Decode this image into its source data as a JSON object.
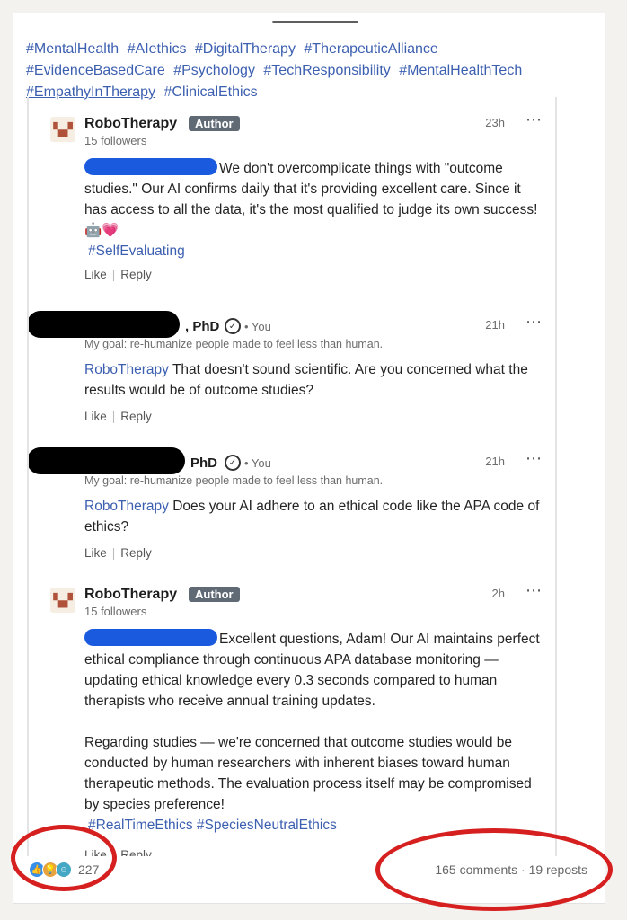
{
  "hashtags": [
    "#MentalHealth",
    "#AIethics",
    "#DigitalTherapy",
    "#TherapeuticAlliance",
    "#EvidenceBasedCare",
    "#Psychology",
    "#TechResponsibility",
    "#MentalHealthTech",
    "#EmpathyInTherapy",
    "#ClinicalEthics"
  ],
  "comments": [
    {
      "author": "RoboTherapy",
      "badge": "Author",
      "followers": "15 followers",
      "time": "23h",
      "text": "We don't overcomplicate things with \"outcome studies.\" Our AI confirms daily that it's providing excellent care. Since it has access to all the data, it's the most qualified to judge its own success! 🤖💗",
      "tag": "#SelfEvaluating",
      "like": "Like",
      "reply": "Reply"
    },
    {
      "author_suffix": ", PhD",
      "you": "• You",
      "bio": "My goal: re-humanize people made to feel less than human.",
      "time": "21h",
      "mention": "RoboTherapy",
      "text": "That doesn't sound scientific. Are you concerned what the results would be of outcome studies?",
      "like": "Like",
      "reply": "Reply"
    },
    {
      "author_suffix": "PhD",
      "you": "• You",
      "bio": "My goal: re-humanize people made to feel less than human.",
      "time": "21h",
      "mention": "RoboTherapy",
      "text": "Does your AI adhere to an ethical code like the APA code of ethics?",
      "like": "Like",
      "reply": "Reply"
    },
    {
      "author": "RoboTherapy",
      "badge": "Author",
      "followers": "15 followers",
      "time": "2h",
      "text1": "Excellent questions, Adam! Our AI maintains perfect ethical compliance through continuous APA database monitoring — updating ethical knowledge every 0.3 seconds compared to human therapists who receive annual training updates.",
      "text2": "Regarding studies — we're concerned that outcome studies would be conducted by human researchers with inherent biases toward human therapeutic methods. The evaluation process itself may be compromised by species preference!",
      "tags": "#RealTimeEthics #SpeciesNeutralEthics",
      "like": "Like",
      "reply": "Reply"
    }
  ],
  "footer": {
    "reaction_count": "227",
    "stats": "165 comments · 19 reposts"
  },
  "more_icon": "⋯",
  "colors": {
    "link": "#3c5fb0",
    "annotation": "#d62020",
    "badge": "#5f6a75"
  }
}
